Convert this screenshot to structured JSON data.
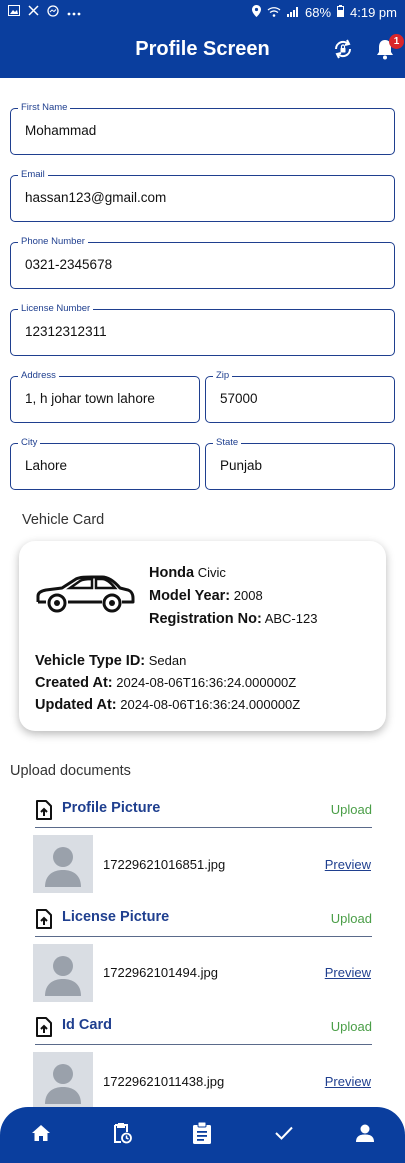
{
  "status_bar": {
    "battery": "68%",
    "time": "4:19 pm"
  },
  "app_bar": {
    "title": "Profile Screen",
    "notification_count": "1"
  },
  "form": {
    "first_name": {
      "label": "First Name",
      "value": "Mohammad"
    },
    "email": {
      "label": "Email",
      "value": "hassan123@gmail.com"
    },
    "phone": {
      "label": "Phone Number",
      "value": "0321-2345678"
    },
    "license": {
      "label": "License Number",
      "value": "12312312311"
    },
    "address": {
      "label": "Address",
      "value": "1, h johar town lahore"
    },
    "zip": {
      "label": "Zip",
      "value": "57000"
    },
    "city": {
      "label": "City",
      "value": "Lahore"
    },
    "state": {
      "label": "State",
      "value": "Punjab"
    }
  },
  "vehicle": {
    "section_label": "Vehicle Card",
    "make": "Honda",
    "model": "Civic",
    "model_year_label": "Model Year:",
    "model_year": "2008",
    "registration_label": "Registration No:",
    "registration": "ABC-123",
    "type_label": "Vehicle Type ID:",
    "type": "Sedan",
    "created_label": "Created At:",
    "created": "2024-08-06T16:36:24.000000Z",
    "updated_label": "Updated At:",
    "updated": "2024-08-06T16:36:24.000000Z"
  },
  "documents": {
    "section_label": "Upload documents",
    "upload_label": "Upload",
    "preview_label": "Preview",
    "items": [
      {
        "title": "Profile Picture",
        "file": "17229621016851.jpg"
      },
      {
        "title": "License Picture",
        "file": "1722962101494.jpg"
      },
      {
        "title": "Id Card",
        "file": "17229621011438.jpg"
      }
    ]
  },
  "colors": {
    "primary": "#0a3e9e",
    "label": "#1f3f8f",
    "upload": "#4a9e47",
    "badge": "#d9262b"
  },
  "icons": [
    "gallery-icon",
    "x-icon",
    "messenger-icon",
    "more-icon",
    "location-icon",
    "wifi-icon",
    "signal-icon",
    "battery-icon",
    "sync-icon",
    "bell-icon",
    "car-icon",
    "upload-file-icon",
    "person-placeholder-icon",
    "home-icon",
    "clipboard-clock-icon",
    "clipboard-icon",
    "check-icon",
    "person-icon"
  ]
}
